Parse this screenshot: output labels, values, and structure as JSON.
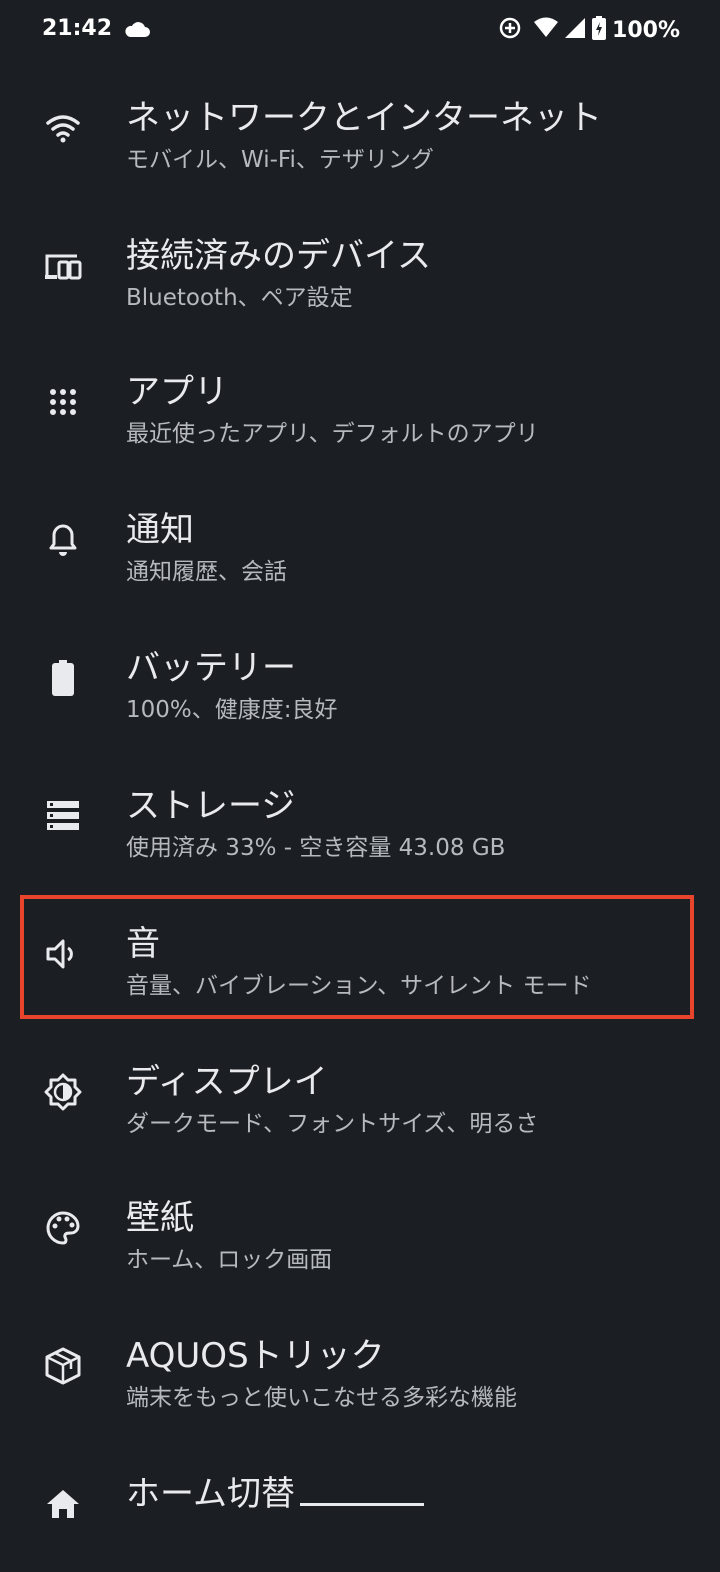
{
  "status_bar": {
    "time": "21:42",
    "battery": "100%",
    "icons": [
      "cloud-icon",
      "data-saver-icon",
      "wifi-icon",
      "signal-icon",
      "battery-charging-icon"
    ]
  },
  "settings": {
    "items": [
      {
        "title": "ネットワークとインターネット",
        "subtitle": "モバイル、Wi-Fi、テザリング",
        "icon": "wifi-icon"
      },
      {
        "title": "接続済みのデバイス",
        "subtitle": "Bluetooth、ペア設定",
        "icon": "devices-icon"
      },
      {
        "title": "アプリ",
        "subtitle": "最近使ったアプリ、デフォルトのアプリ",
        "icon": "apps-grid-icon"
      },
      {
        "title": "通知",
        "subtitle": "通知履歴、会話",
        "icon": "bell-icon"
      },
      {
        "title": "バッテリー",
        "subtitle": "100%、健康度:良好",
        "icon": "battery-icon"
      },
      {
        "title": "ストレージ",
        "subtitle": "使用済み 33% - 空き容量 43.08 GB",
        "icon": "storage-icon"
      },
      {
        "title": "音",
        "subtitle": "音量、バイブレーション、サイレント モード",
        "icon": "volume-icon"
      },
      {
        "title": "ディスプレイ",
        "subtitle": "ダークモード、フォントサイズ、明るさ",
        "icon": "brightness-icon"
      },
      {
        "title": "壁紙",
        "subtitle": "ホーム、ロック画面",
        "icon": "palette-icon"
      },
      {
        "title": "AQUOSトリック",
        "subtitle": "端末をもっと使いこなせる多彩な機能",
        "icon": "aquos-cube-icon"
      },
      {
        "title": "ホーム切替",
        "subtitle": "",
        "icon": "home-icon"
      }
    ]
  },
  "colors": {
    "background": "#1b1e22",
    "title": "#e8eaed",
    "subtitle": "#b6b9bd",
    "highlight": "#e8452c"
  }
}
